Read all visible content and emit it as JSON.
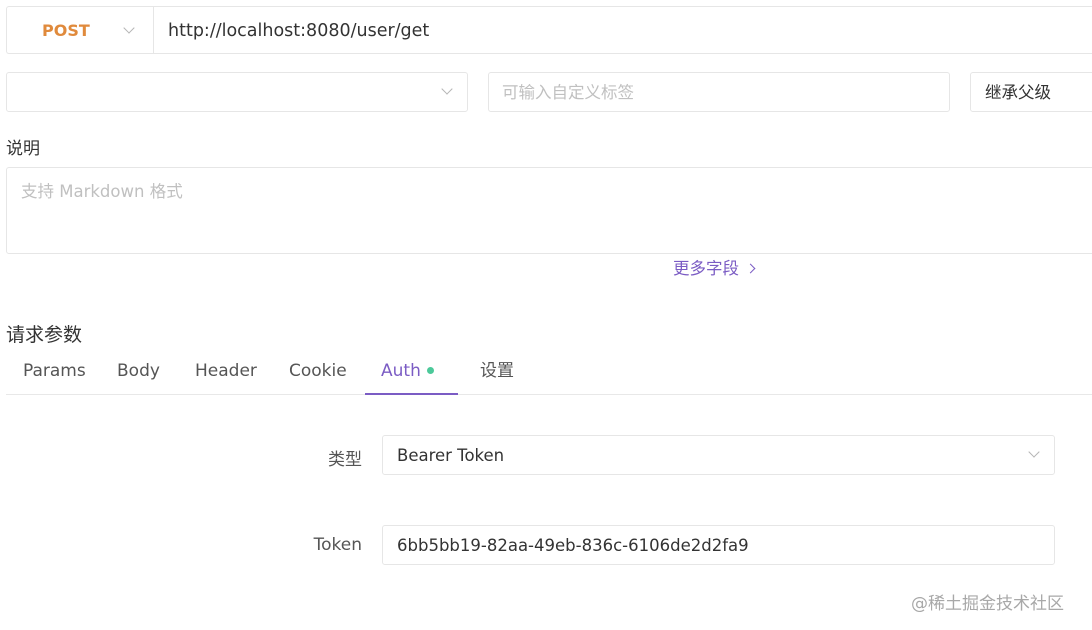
{
  "request": {
    "method": "POST",
    "url": "http://localhost:8080/user/get"
  },
  "meta_row": {
    "folder_value": "",
    "tag_placeholder": "可输入自定义标签",
    "inherit_value": "继承父级"
  },
  "description": {
    "label": "说明",
    "placeholder": "支持 Markdown 格式",
    "more_fields": "更多字段"
  },
  "params": {
    "title": "请求参数",
    "tabs": [
      {
        "label": "Params",
        "active": false
      },
      {
        "label": "Body",
        "active": false
      },
      {
        "label": "Header",
        "active": false
      },
      {
        "label": "Cookie",
        "active": false
      },
      {
        "label": "Auth",
        "active": true,
        "has_dot": true
      },
      {
        "label": "设置",
        "active": false
      }
    ]
  },
  "auth": {
    "type_label": "类型",
    "type_value": "Bearer Token",
    "token_label": "Token",
    "token_value": "6bb5bb19-82aa-49eb-836c-6106de2d2fa9"
  },
  "watermark": "@稀土掘金技术社区",
  "colors": {
    "method": "#e08a3c",
    "accent": "#7b5cc4",
    "dot": "#4cc99a"
  }
}
